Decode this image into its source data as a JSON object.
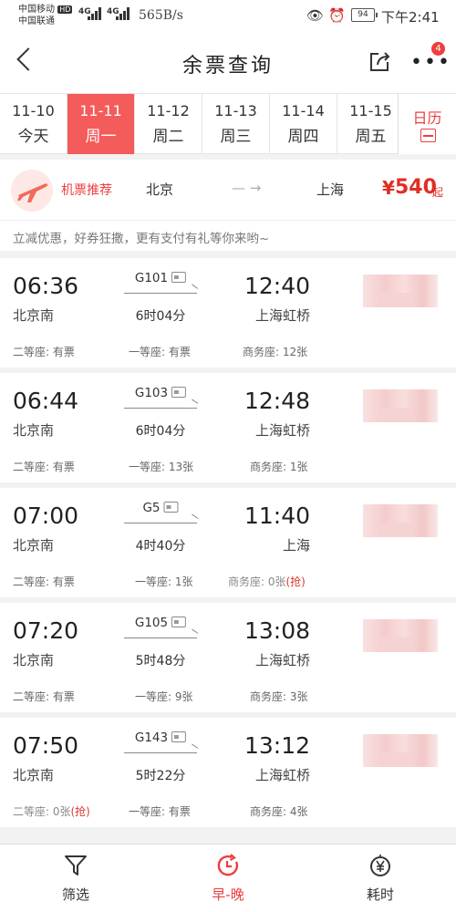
{
  "status": {
    "carrier1": "中国移动",
    "carrier1_badge": "HD",
    "carrier2": "中国联通",
    "net1": "4G",
    "net2": "4G",
    "speed": "565B/s",
    "battery": "94",
    "time": "下午2:41"
  },
  "nav": {
    "title": "余票查询",
    "badge": "4"
  },
  "dates": [
    {
      "date": "11-10",
      "weekday": "今天"
    },
    {
      "date": "11-11",
      "weekday": "周一",
      "active": true
    },
    {
      "date": "11-12",
      "weekday": "周二"
    },
    {
      "date": "11-13",
      "weekday": "周三"
    },
    {
      "date": "11-14",
      "weekday": "周四"
    },
    {
      "date": "11-15",
      "weekday": "周五"
    }
  ],
  "calendar_label": "日历",
  "promo": {
    "tag": "机票推荐",
    "from": "北京",
    "arrow": "— →",
    "to": "上海",
    "price_symbol": "¥",
    "price": "540",
    "price_suffix": "起",
    "subtitle": "立减优惠，好券狂撒，更有支付有礼等你来哟~"
  },
  "trains": [
    {
      "dep": "06:36",
      "dep_station": "北京南",
      "no": "G101",
      "duration": "6时04分",
      "arr": "12:40",
      "arr_station": "上海虹桥",
      "seat1": "二等座: 有票",
      "seat2": "一等座: 有票",
      "seat3": "商务座: 12张",
      "grab": ""
    },
    {
      "dep": "06:44",
      "dep_station": "北京南",
      "no": "G103",
      "duration": "6时04分",
      "arr": "12:48",
      "arr_station": "上海虹桥",
      "seat1": "二等座: 有票",
      "seat2": "一等座: 13张",
      "seat3": "商务座: 1张",
      "grab": ""
    },
    {
      "dep": "07:00",
      "dep_station": "北京南",
      "no": "G5",
      "duration": "4时40分",
      "arr": "11:40",
      "arr_station": "上海",
      "seat1": "二等座: 有票",
      "seat2": "一等座: 1张",
      "seat3": "商务座: 0张",
      "grab": "(抢)"
    },
    {
      "dep": "07:20",
      "dep_station": "北京南",
      "no": "G105",
      "duration": "5时48分",
      "arr": "13:08",
      "arr_station": "上海虹桥",
      "seat1": "二等座: 有票",
      "seat2": "一等座: 9张",
      "seat3": "商务座: 3张",
      "grab": ""
    },
    {
      "dep": "07:50",
      "dep_station": "北京南",
      "no": "G143",
      "duration": "5时22分",
      "arr": "13:12",
      "arr_station": "上海虹桥",
      "seat1": "二等座: 0张",
      "seat1_grab": "(抢)",
      "seat2": "一等座: 有票",
      "seat3": "商务座: 4张",
      "grab": ""
    }
  ],
  "bottom": {
    "filter": "筛选",
    "sort_time": "早-晚",
    "duration": "耗时"
  },
  "colors": {
    "accent": "#ee3e3e",
    "active_tab": "#f45b5b",
    "price": "#e02e24"
  }
}
